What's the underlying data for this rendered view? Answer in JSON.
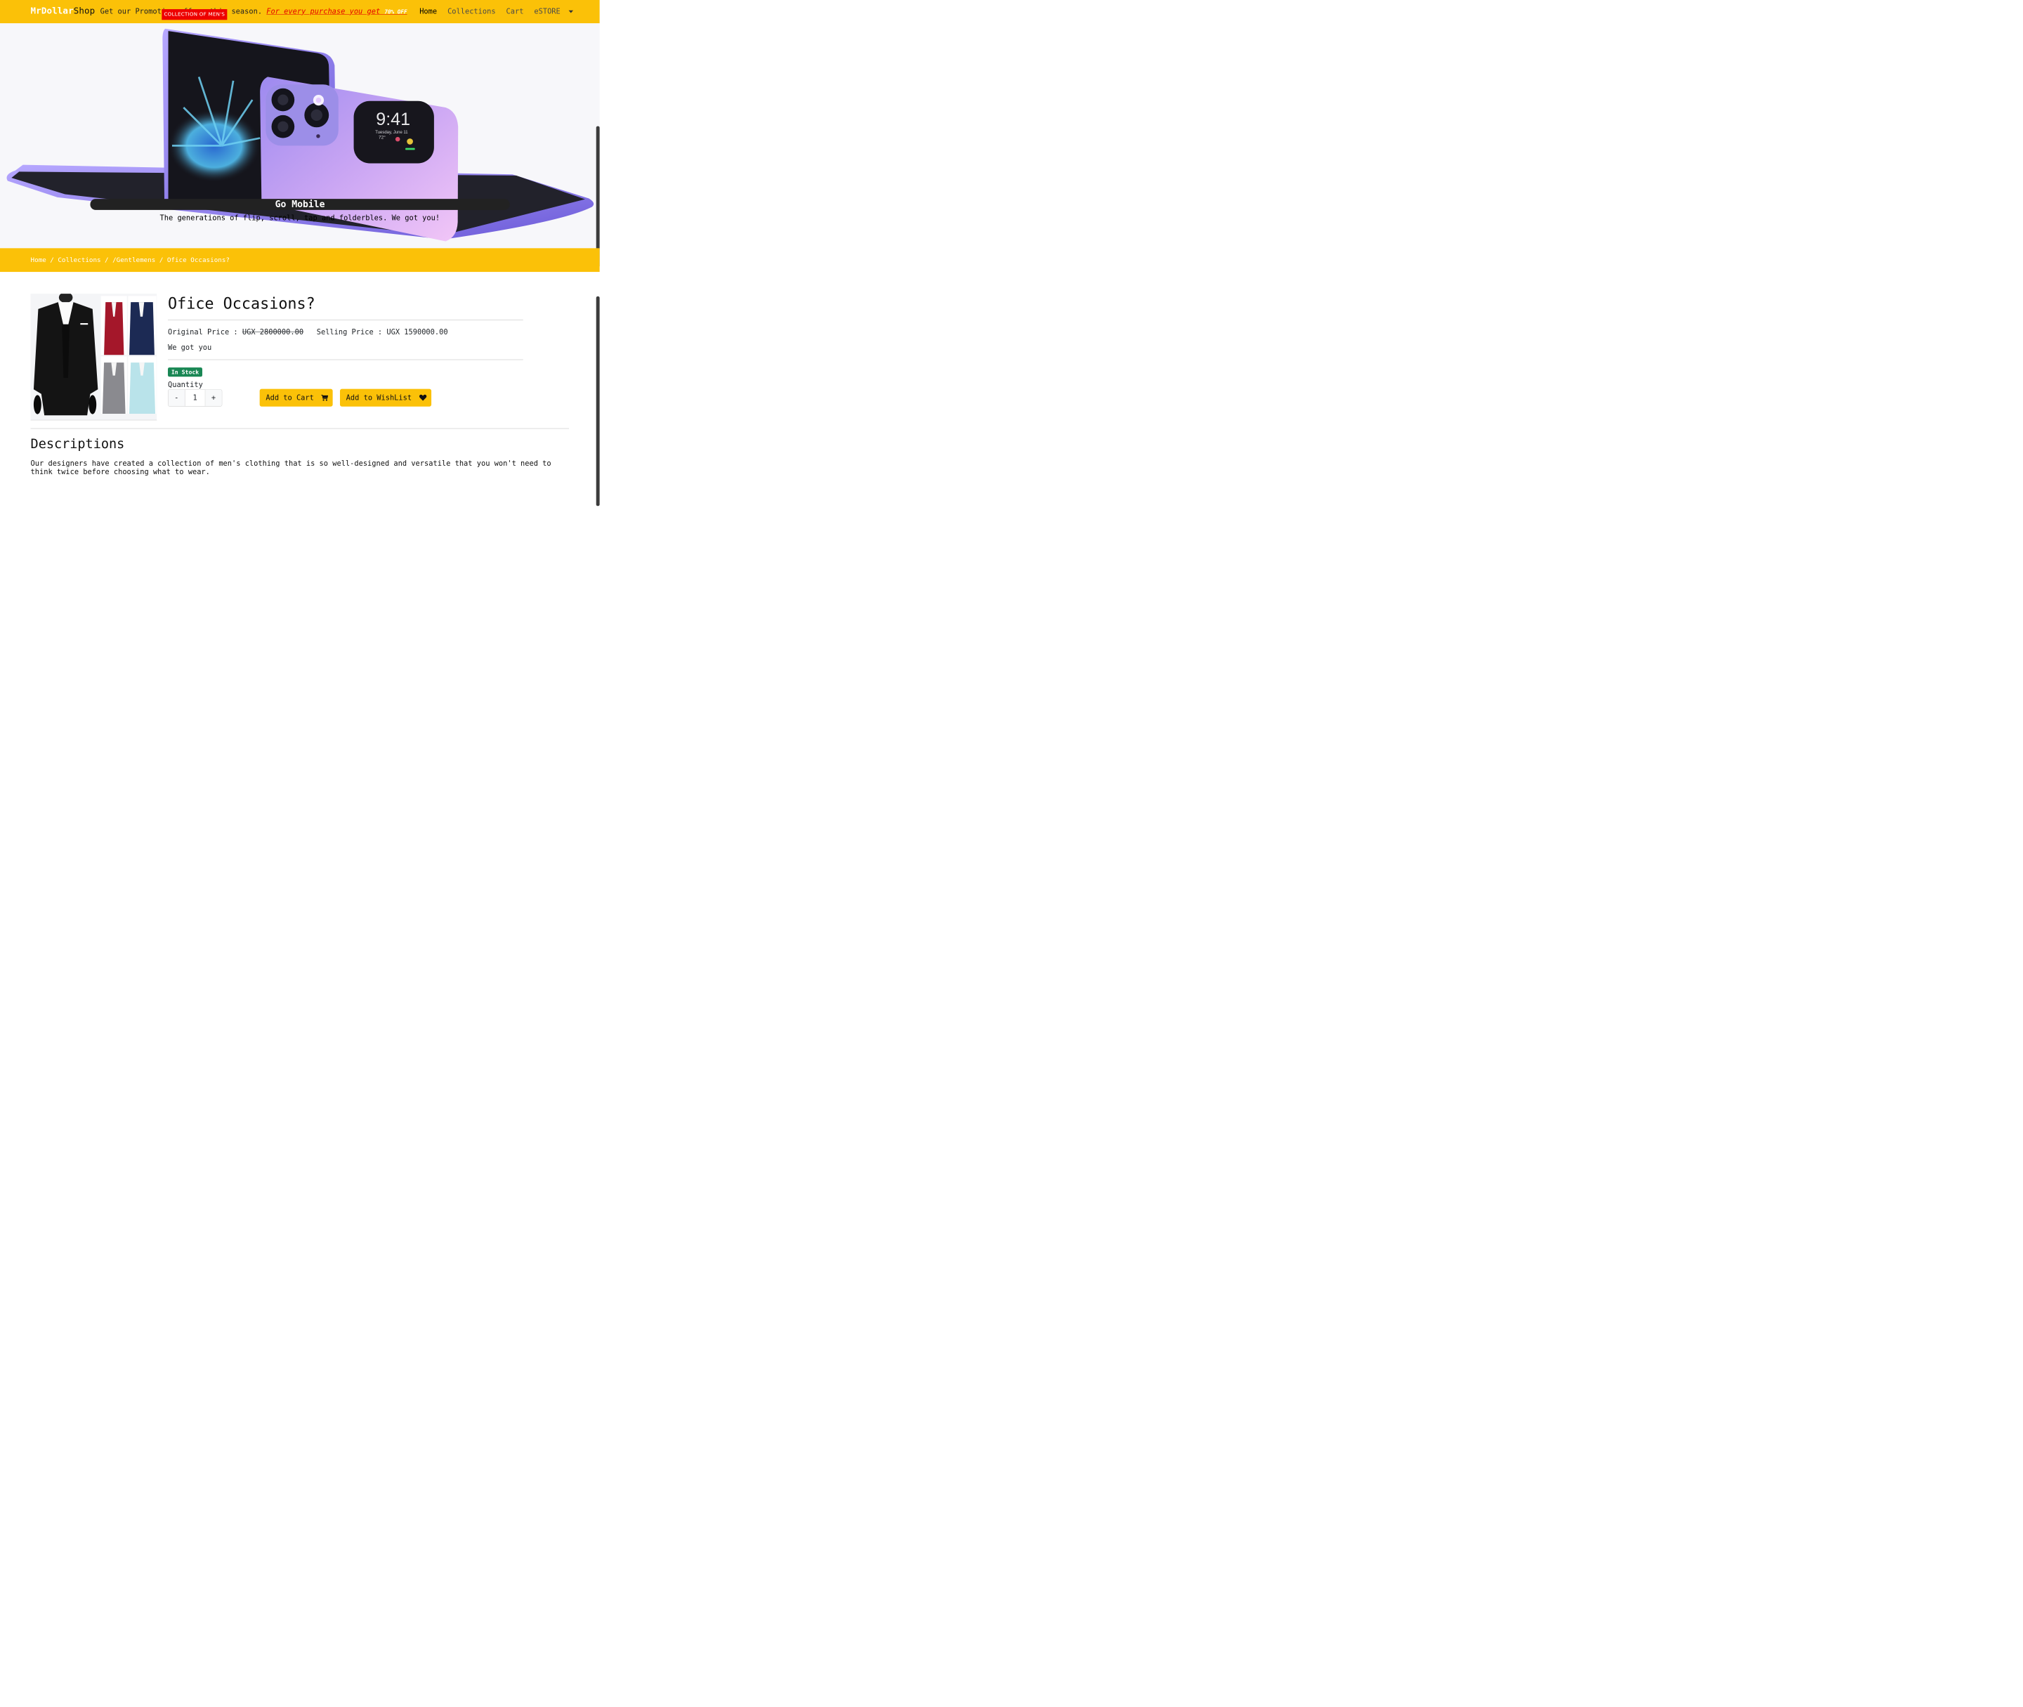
{
  "navbar": {
    "brand_part1": "MrDollar",
    "brand_part2": "Shop",
    "marquee_text": "Get our Promotion offers this season. ",
    "marquee_link": "For every purchase you get ",
    "marquee_off": "70% OFF",
    "mens_badge": "COLLECTION OF MEN'S",
    "links": [
      "Home",
      "Collections",
      "Cart",
      "eSTORE"
    ]
  },
  "hero": {
    "title": "Go Mobile",
    "subtitle": "The generations of flip, scroll, tap and folderbles. We got you!",
    "phone_time": "9:41",
    "phone_date": "Tuesday, June 11",
    "phone_temp": "72°"
  },
  "breadcrumb": [
    "Home",
    "Collections",
    "/Gentlemens",
    "Ofice Occasions?"
  ],
  "product": {
    "title": "Ofice Occasions?",
    "original_label": "Original Price : ",
    "original_price": "UGX 2800000.00",
    "selling_label": "Selling Price : ",
    "selling_price": "UGX 1590000.00",
    "tagline": "We got you",
    "stock": "In Stock",
    "quantity_label": "Quantity",
    "quantity_value": "1",
    "minus": "-",
    "plus": "+",
    "add_to_cart": "Add to Cart",
    "add_to_wishlist": "Add to WishList"
  },
  "description": {
    "title": "Descriptions",
    "text": "Our designers have created a collection of men's clothing that is so well-designed and versatile that you won't need to think twice before choosing what to wear."
  },
  "colors": {
    "accent": "#fbc108",
    "badge_red": "#ee0000",
    "stock_green": "#198754"
  },
  "icons": [
    "cart-icon",
    "heart-icon",
    "caret-down-icon"
  ]
}
